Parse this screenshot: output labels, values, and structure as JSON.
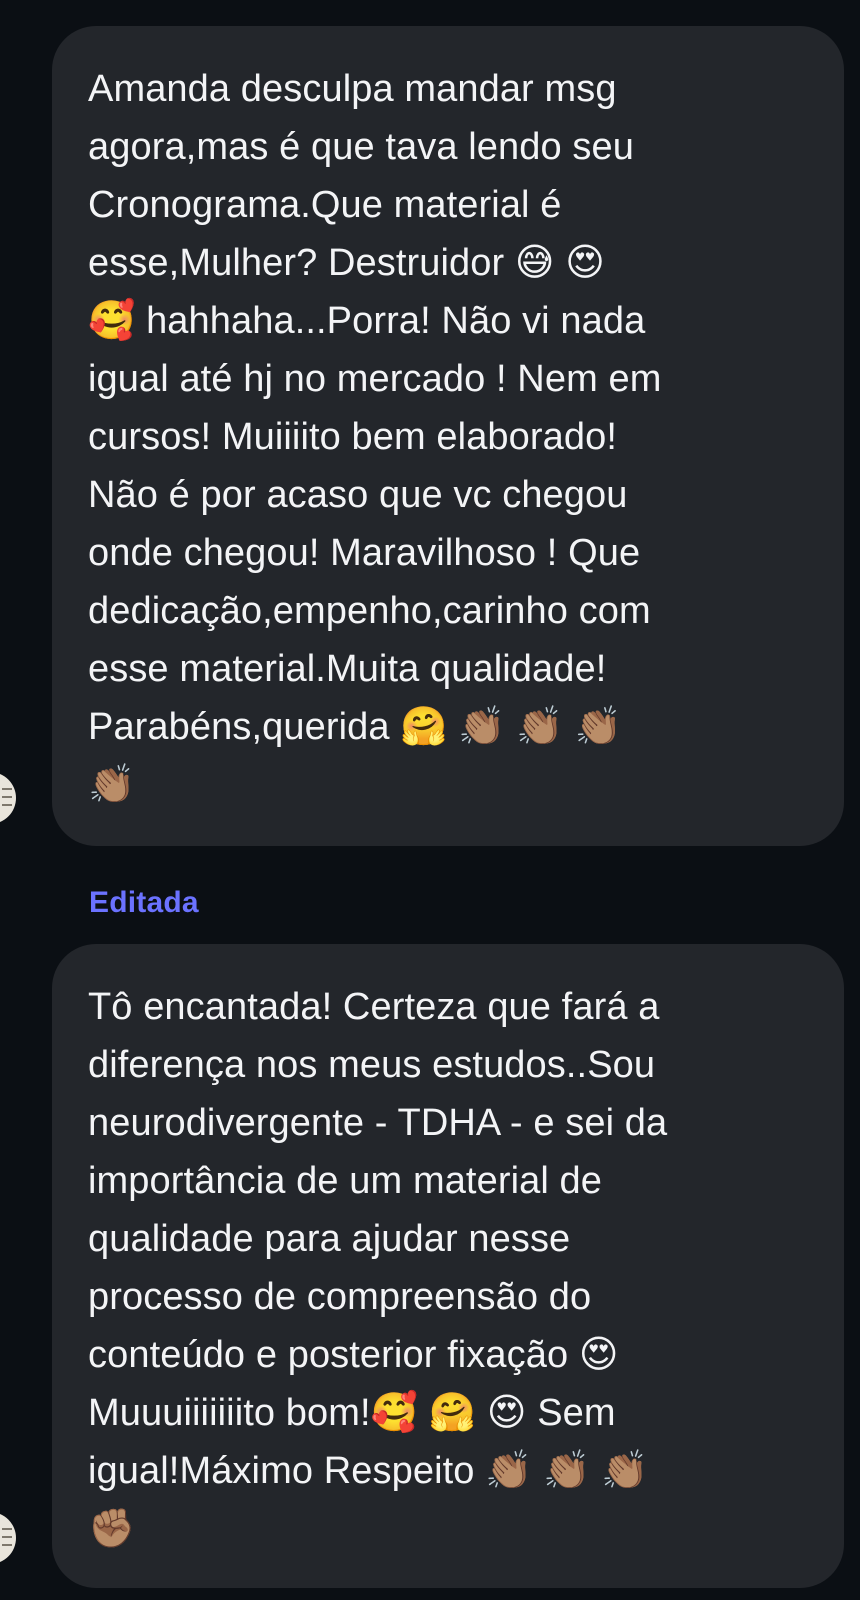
{
  "messages": [
    {
      "text": "Amanda desculpa mandar msg\nagora,mas é que tava lendo seu\nCronograma.Que material é\nesse,Mulher? Destruidor 😅 😍\n🥰 hahhaha...Porra! Não vi nada\nigual até hj no mercado ! Nem em\ncursos! Muiiiito bem elaborado!\nNão é por acaso que vc chegou\nonde chegou! Maravilhoso  ! Que\ndedicação,empenho,carinho com\nesse material.Muita qualidade!\nParabéns,querida 🤗 👏🏽 👏🏽 👏🏽\n👏🏽"
    },
    {
      "edited_label": "Editada",
      "text": "Tô encantada! Certeza que fará a\ndiferença nos meus estudos..Sou\nneurodivergente - TDHA - e sei da\nimportância de um material de\nqualidade para ajudar nesse\nprocesso de  compreensão do\nconteúdo e posterior fixação 😍\nMuuuiiiiiiito bom!🥰 🤗 😍 Sem\nigual!Máximo Respeito 👏🏽 👏🏽 👏🏽\n✊🏽"
    }
  ]
}
